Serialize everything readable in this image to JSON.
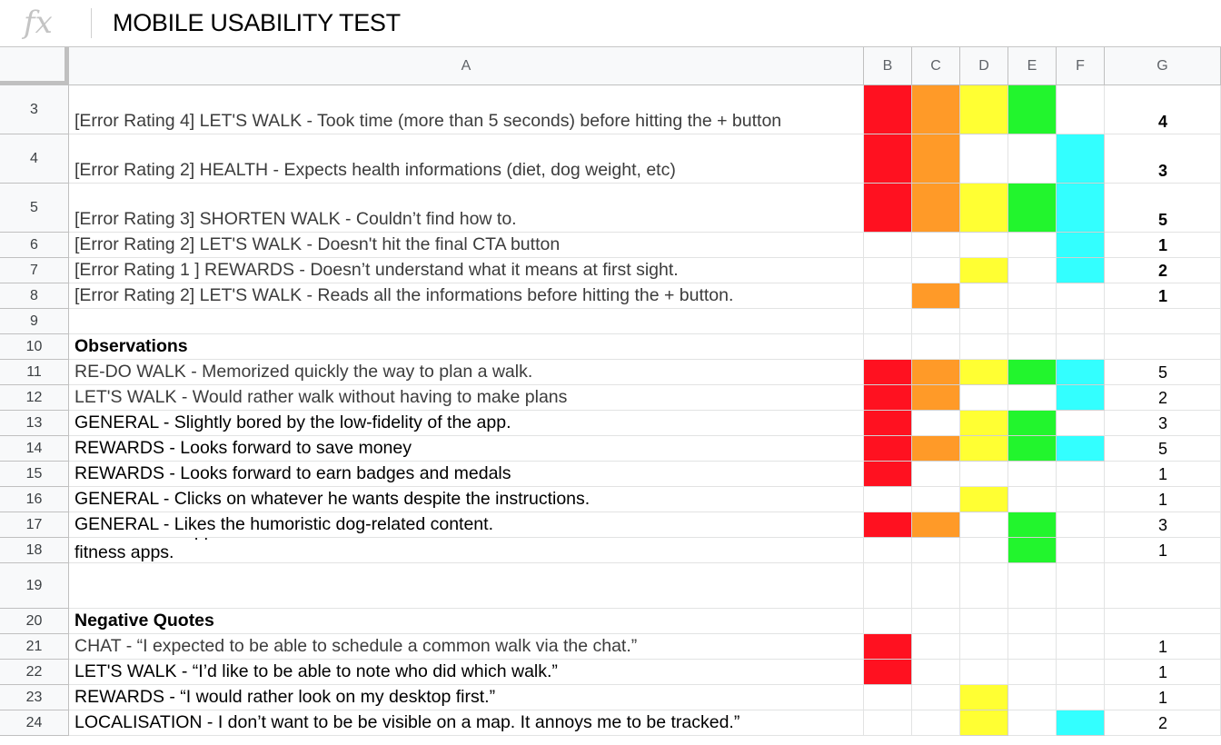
{
  "toolbar": {
    "fx_icon": "fx",
    "formula_value": "MOBILE USABILITY TEST"
  },
  "columns": [
    "A",
    "B",
    "C",
    "D",
    "E",
    "F",
    "G"
  ],
  "palette": {
    "red": "#ff1120",
    "orange": "#ff9a28",
    "yellow": "#ffff33",
    "green": "#22f52d",
    "cyan": "#33ffff"
  },
  "rows": [
    {
      "num": "3",
      "a": "[Error Rating 4] LET'S WALK - Took time (more than 5 seconds) before hitting the + button",
      "g": "4",
      "style": "gray",
      "gbold": true,
      "colors": [
        "red",
        "orange",
        "yellow",
        "green",
        ""
      ]
    },
    {
      "num": "4",
      "a": "[Error Rating 2]  HEALTH - Expects health informations (diet, dog weight, etc)",
      "g": "3",
      "style": "gray",
      "gbold": true,
      "colors": [
        "red",
        "orange",
        "",
        "",
        "cyan"
      ]
    },
    {
      "num": "5",
      "a": "[Error Rating 3] SHORTEN WALK - Couldn’t find how to.",
      "g": "5",
      "style": "gray",
      "gbold": true,
      "colors": [
        "red",
        "orange",
        "yellow",
        "green",
        "cyan"
      ]
    },
    {
      "num": "6",
      "a": "[Error Rating 2] LET'S WALK - Doesn't hit the final CTA button",
      "g": "1",
      "style": "gray",
      "gbold": true,
      "colors": [
        "",
        "",
        "",
        "",
        "cyan"
      ]
    },
    {
      "num": "7",
      "a": "[Error Rating 1 ] REWARDS - Doesn’t understand what it means at first sight.",
      "g": "2",
      "style": "gray",
      "gbold": true,
      "colors": [
        "",
        "",
        "yellow",
        "",
        "cyan"
      ]
    },
    {
      "num": "8",
      "a": "[Error Rating 2] LET'S WALK - Reads all the informations before hitting the + button.",
      "g": "1",
      "style": "gray",
      "gbold": true,
      "colors": [
        "",
        "orange",
        "",
        "",
        ""
      ]
    },
    {
      "num": "9",
      "a": "",
      "g": "",
      "style": "",
      "gbold": false,
      "colors": [
        "",
        "",
        "",
        "",
        ""
      ]
    },
    {
      "num": "10",
      "a": "Observations",
      "g": "",
      "style": "bold",
      "gbold": false,
      "colors": [
        "",
        "",
        "",
        "",
        ""
      ]
    },
    {
      "num": "11",
      "a": "RE-DO WALK - Memorized quickly the way to plan a walk.",
      "g": "5",
      "style": "gray",
      "gbold": false,
      "colors": [
        "red",
        "orange",
        "yellow",
        "green",
        "cyan"
      ]
    },
    {
      "num": "12",
      "a": "LET'S WALK - Would rather walk without having to make plans",
      "g": "2",
      "style": "gray",
      "gbold": false,
      "colors": [
        "red",
        "orange",
        "",
        "",
        "cyan"
      ]
    },
    {
      "num": "13",
      "a": "GENERAL - Slightly bored by the low-fidelity of the app.",
      "g": "3",
      "style": "",
      "gbold": false,
      "colors": [
        "red",
        "",
        "yellow",
        "green",
        ""
      ]
    },
    {
      "num": "14",
      "a": "REWARDS - Looks forward to save money",
      "g": "5",
      "style": "",
      "gbold": false,
      "colors": [
        "red",
        "orange",
        "yellow",
        "green",
        "cyan"
      ]
    },
    {
      "num": "15",
      "a": "REWARDS - Looks forward to earn badges and medals",
      "g": "1",
      "style": "",
      "gbold": false,
      "colors": [
        "red",
        "",
        "",
        "",
        ""
      ]
    },
    {
      "num": "16",
      "a": "GENERAL - Clicks on whatever he wants despite the instructions.",
      "g": "1",
      "style": "",
      "gbold": false,
      "colors": [
        "",
        "",
        "yellow",
        "",
        ""
      ]
    },
    {
      "num": "17",
      "a": "GENERAL - Likes the humoristic dog-related content.",
      "g": "3",
      "style": "",
      "gbold": false,
      "colors": [
        "red",
        "orange",
        "",
        "green",
        ""
      ]
    },
    {
      "num": "18",
      "a": "HEALTH - Disappointed because he can't find as much informations as what he is used to in his fitness apps.",
      "g": "1",
      "style": "",
      "gbold": false,
      "colors": [
        "",
        "",
        "",
        "green",
        ""
      ]
    },
    {
      "num": "19",
      "a": "",
      "g": "",
      "style": "",
      "gbold": false,
      "colors": [
        "",
        "",
        "",
        "",
        ""
      ]
    },
    {
      "num": "20",
      "a": "Negative Quotes",
      "g": "",
      "style": "bold",
      "gbold": false,
      "colors": [
        "",
        "",
        "",
        "",
        ""
      ]
    },
    {
      "num": "21",
      "a": "CHAT - “I expected to be able to schedule a common walk via the chat.”",
      "g": "1",
      "style": "gray",
      "gbold": false,
      "colors": [
        "red",
        "",
        "",
        "",
        ""
      ]
    },
    {
      "num": "22",
      "a": "LET'S WALK - “I’d like to be able to note who did which walk.”",
      "g": "1",
      "style": "",
      "gbold": false,
      "colors": [
        "red",
        "",
        "",
        "",
        ""
      ]
    },
    {
      "num": "23",
      "a": "REWARDS - “I would rather look on my desktop first.”",
      "g": "1",
      "style": "",
      "gbold": false,
      "colors": [
        "",
        "",
        "yellow",
        "",
        ""
      ]
    },
    {
      "num": "24",
      "a": "LOCALISATION - I don’t want to be be visible on a map. It annoys me to be tracked.”",
      "g": "2",
      "style": "",
      "gbold": false,
      "colors": [
        "",
        "",
        "yellow",
        "",
        "cyan"
      ]
    }
  ]
}
